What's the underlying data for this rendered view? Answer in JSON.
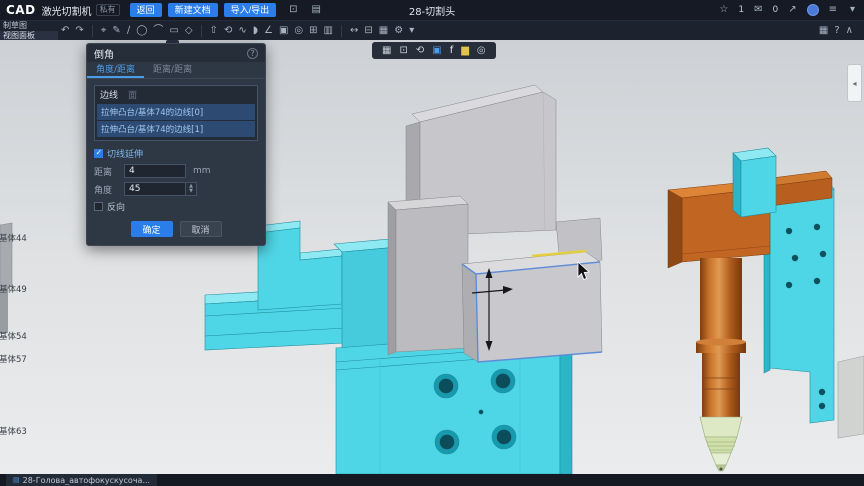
{
  "titlebar": {
    "app_logo": "CAD",
    "doc_name": "激光切割机",
    "privacy_badge": "私有",
    "back_button": "返回",
    "new_doc_button": "新建文档",
    "import_export_button": "导入/导出",
    "title": "28-切割头",
    "like_count": "1",
    "comment_count": "0",
    "left_icons": [
      {
        "name": "save-icon",
        "glyph": "⊡"
      },
      {
        "name": "history-icon",
        "glyph": "▤"
      }
    ]
  },
  "toolbar": {
    "left_label": "制草图",
    "panel_label": "视图面板",
    "icons": [
      {
        "name": "undo-icon",
        "glyph": "↶"
      },
      {
        "name": "redo-icon",
        "glyph": "↷"
      },
      {
        "sep": true
      },
      {
        "name": "select-icon",
        "glyph": "⌖"
      },
      {
        "name": "sketch-icon",
        "glyph": "✎"
      },
      {
        "name": "line-icon",
        "glyph": "∕"
      },
      {
        "name": "circle-icon",
        "glyph": "◯"
      },
      {
        "name": "arc-icon",
        "glyph": "⌒"
      },
      {
        "name": "rectangle-icon",
        "glyph": "▭"
      },
      {
        "name": "polygon-icon",
        "glyph": "◇"
      },
      {
        "sep": true
      },
      {
        "name": "extrude-icon",
        "glyph": "⇧"
      },
      {
        "name": "revolve-icon",
        "glyph": "⟲"
      },
      {
        "name": "sweep-icon",
        "glyph": "∿"
      },
      {
        "name": "fillet-icon",
        "glyph": "◗"
      },
      {
        "name": "chamfer-icon",
        "glyph": "∠"
      },
      {
        "name": "shell-icon",
        "glyph": "▣"
      },
      {
        "name": "hole-icon",
        "glyph": "◎"
      },
      {
        "name": "pattern-icon",
        "glyph": "⊞"
      },
      {
        "name": "mirror-icon",
        "glyph": "▥"
      },
      {
        "sep": true
      },
      {
        "name": "measure-icon",
        "glyph": "↔"
      },
      {
        "name": "section-icon",
        "glyph": "⊟"
      },
      {
        "name": "view-mode-icon",
        "glyph": "▦"
      },
      {
        "name": "settings-icon",
        "glyph": "⚙"
      },
      {
        "name": "more-tools-icon",
        "glyph": "▾"
      }
    ],
    "right_icons": [
      {
        "name": "display-settings-icon",
        "glyph": "▦"
      },
      {
        "name": "help-icon",
        "glyph": "?"
      },
      {
        "name": "collapse-toolbar-icon",
        "glyph": "∧"
      }
    ]
  },
  "viewport": {
    "float_icons": [
      {
        "name": "grid-icon",
        "glyph": "▦",
        "color": "#c9d0d8"
      },
      {
        "name": "fit-view-icon",
        "glyph": "⊡",
        "color": "#c9d0d8"
      },
      {
        "name": "orbit-icon",
        "glyph": "⟲",
        "color": "#c9d0d8"
      },
      {
        "name": "shading-mode-icon",
        "glyph": "▣",
        "color": "#4a9be8"
      },
      {
        "name": "annotate-icon",
        "glyph": "f",
        "color": "#e4e8ee"
      },
      {
        "name": "layers-icon",
        "glyph": "▆",
        "color": "#e3c44a"
      },
      {
        "name": "section-view-icon",
        "glyph": "◎",
        "color": "#c9d0d8"
      }
    ],
    "feature_labels": [
      "基体44",
      "基体49",
      "基体54",
      "基体57",
      "基体63"
    ],
    "right_handle_glyph": "◂",
    "corner_btn_glyph": "⊞"
  },
  "dialog": {
    "title": "倒角",
    "help": "?",
    "tabs": [
      {
        "label": "角度/距离",
        "active": true
      },
      {
        "label": "距离/距离",
        "active": false
      }
    ],
    "list_title": "边线",
    "list_title2": "面",
    "items": [
      "拉伸凸台/基体74的边线[0]",
      "拉伸凸台/基体74的边线[1]"
    ],
    "tangent_label": "切线延伸",
    "tangent_checked": true,
    "distance_label": "距离",
    "distance_value": "4",
    "distance_unit": "mm",
    "angle_label": "角度",
    "angle_value": "45",
    "reverse_label": "反向",
    "reverse_checked": false,
    "ok_button": "确定",
    "cancel_button": "取消"
  },
  "statusbar": {
    "doc_tab": "28-Голова_автофокускусоча..."
  },
  "colors": {
    "accent_blue": "#2b7de9",
    "cyan_part": "#4fd6e6",
    "gray_part": "#c9c9cd",
    "orange_part": "#c06522",
    "highlight_yellow": "#e6cf3e",
    "highlight_edge_blue": "#5f8cd8"
  }
}
